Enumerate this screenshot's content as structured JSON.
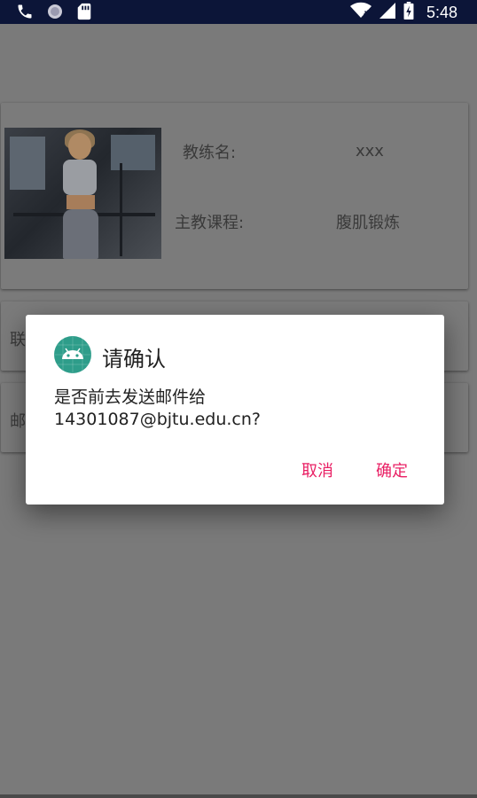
{
  "status_bar": {
    "time": "5:48",
    "left_icons": [
      "phone-icon",
      "sync-icon",
      "sd-card-icon"
    ],
    "right_icons": [
      "wifi-icon",
      "signal-icon",
      "battery-icon"
    ]
  },
  "coach_card": {
    "coach_name_label": "教练名:",
    "coach_name_value": "xxx",
    "course_label": "主教课程:",
    "course_value": "腹肌锻炼"
  },
  "contact_card": {
    "label": "联"
  },
  "email_card": {
    "label": "邮"
  },
  "dialog": {
    "title": "请确认",
    "message_line1": "是否前去发送邮件给",
    "message_line2": "14301087@bjtu.edu.cn?",
    "cancel_label": "取消",
    "ok_label": "确定",
    "accent_color": "#e91e63",
    "icon_color": "#2e9d8a"
  }
}
